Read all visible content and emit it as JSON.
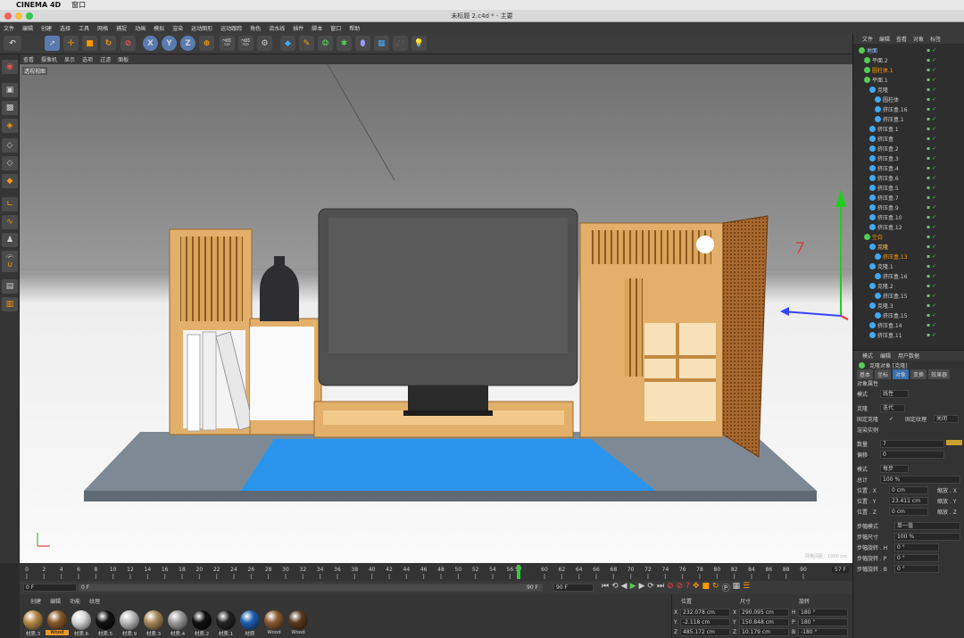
{
  "mac": {
    "app": "CINEMA 4D",
    "menu": "窗口"
  },
  "title": "未标题 2.c4d * - 主要",
  "menus": [
    "文件",
    "编辑",
    "创建",
    "选择",
    "工具",
    "网格",
    "捕捉",
    "动画",
    "模拟",
    "渲染",
    "运动图形",
    "运动跟踪",
    "角色",
    "流水线",
    "插件",
    "脚本",
    "窗口",
    "帮助"
  ],
  "viewport": {
    "menus": [
      "查看",
      "摄像机",
      "显示",
      "选项",
      "过滤",
      "面板"
    ],
    "label": "透视视图",
    "grid": "网格间距：1000 cm"
  },
  "timeline": {
    "ticks": [
      "0",
      "2",
      "4",
      "6",
      "8",
      "10",
      "12",
      "14",
      "16",
      "18",
      "20",
      "22",
      "24",
      "26",
      "28",
      "30",
      "32",
      "34",
      "36",
      "38",
      "40",
      "42",
      "44",
      "46",
      "48",
      "50",
      "52",
      "54",
      "56",
      "57",
      "60",
      "62",
      "64",
      "66",
      "68",
      "70",
      "72",
      "74",
      "76",
      "78",
      "80",
      "82",
      "84",
      "86",
      "88",
      "90"
    ],
    "current": "57 F"
  },
  "transport": {
    "start": "0 F",
    "startb": "0 F",
    "end": "90 F",
    "endb": "90 F"
  },
  "matbar": {
    "menus": [
      "创建",
      "编辑",
      "功能",
      "纹理"
    ],
    "materials": [
      "材质.3",
      "Wood",
      "材质.6",
      "材质.5",
      "材质.9",
      "材质.3",
      "材质.4",
      "材质.2",
      "材质.1",
      "材质",
      "Wood",
      "Wood"
    ],
    "colors": [
      "#b58a4a",
      "#8b5a2b",
      "#d8d8d8",
      "#111111",
      "#bdbdbd",
      "#a88a5a",
      "#9e9e9e",
      "#111111",
      "#222222",
      "#1f5fb0",
      "#8a5a30",
      "#5a3a20"
    ]
  },
  "coords": {
    "headers": [
      "位置",
      "尺寸",
      "旋转"
    ],
    "rows": [
      [
        "X",
        "232.078 cm",
        "X",
        "290.095 cm",
        "H",
        "180 °"
      ],
      [
        "Y",
        "-2.118 cm",
        "Y",
        "150.848 cm",
        "P",
        "180 °"
      ],
      [
        "Z",
        "485.172 cm",
        "Z",
        "10.179 cm",
        "B",
        "-180 °"
      ]
    ]
  },
  "objmgr": {
    "tabs": [
      "文件",
      "编辑",
      "查看",
      "对象",
      "标签"
    ],
    "items": [
      {
        "name": "地面",
        "indent": 0,
        "color": "#9cf"
      },
      {
        "name": "平面.2",
        "indent": 1,
        "color": "#ccc"
      },
      {
        "name": "圆柱体.1",
        "indent": 1,
        "color": "#f90"
      },
      {
        "name": "平面.1",
        "indent": 1,
        "color": "#ccc"
      },
      {
        "name": "克隆",
        "indent": 2,
        "color": "#ccc"
      },
      {
        "name": "圆柱体",
        "indent": 3,
        "color": "#ccc"
      },
      {
        "name": "挤压盒.16",
        "indent": 3,
        "color": "#ccc"
      },
      {
        "name": "挤压盒.1",
        "indent": 3,
        "color": "#ccc"
      },
      {
        "name": "挤压盒.1",
        "indent": 2,
        "color": "#ccc"
      },
      {
        "name": "挤压盒",
        "indent": 2,
        "color": "#ccc"
      },
      {
        "name": "挤压盒.2",
        "indent": 2,
        "color": "#ccc"
      },
      {
        "name": "挤压盒.3",
        "indent": 2,
        "color": "#ccc"
      },
      {
        "name": "挤压盒.4",
        "indent": 2,
        "color": "#ccc"
      },
      {
        "name": "挤压盒.6",
        "indent": 2,
        "color": "#ccc"
      },
      {
        "name": "挤压盒.5",
        "indent": 2,
        "color": "#ccc"
      },
      {
        "name": "挤压盒.7",
        "indent": 2,
        "color": "#ccc"
      },
      {
        "name": "挤压盒.9",
        "indent": 2,
        "color": "#ccc"
      },
      {
        "name": "挤压盒.10",
        "indent": 2,
        "color": "#ccc"
      },
      {
        "name": "挤压盒.12",
        "indent": 2,
        "color": "#ccc"
      },
      {
        "name": "空白",
        "indent": 1,
        "color": "#f90"
      },
      {
        "name": "克隆",
        "indent": 2,
        "color": "#fc6"
      },
      {
        "name": "挤压盒.13",
        "indent": 3,
        "color": "#f90"
      },
      {
        "name": "克隆.1",
        "indent": 2,
        "color": "#ccc"
      },
      {
        "name": "挤压盒.16",
        "indent": 3,
        "color": "#ccc"
      },
      {
        "name": "克隆.2",
        "indent": 2,
        "color": "#ccc"
      },
      {
        "name": "挤压盒.15",
        "indent": 3,
        "color": "#ccc"
      },
      {
        "name": "克隆.3",
        "indent": 2,
        "color": "#ccc"
      },
      {
        "name": "挤压盒.15",
        "indent": 3,
        "color": "#ccc"
      },
      {
        "name": "挤压盒.14",
        "indent": 2,
        "color": "#ccc"
      },
      {
        "name": "挤压盒.11",
        "indent": 2,
        "color": "#ccc"
      }
    ]
  },
  "attr": {
    "tabs": [
      "模式",
      "编辑",
      "用户数据"
    ],
    "title": "克隆对象 [克隆]",
    "subtabs": [
      "基本",
      "坐标",
      "对象",
      "变换",
      "效果器"
    ],
    "section": "对象属性",
    "mode_label": "模式",
    "mode_val": "线性",
    "clones_label": "克隆",
    "clones_val": "迭代",
    "fix_label": "固定克隆",
    "fix_val": "✓",
    "fixtex_label": "固定纹理",
    "fixtex_val": "关闭",
    "render_label": "渲染实例",
    "count_label": "数量",
    "count_val": "7",
    "offset_label": "偏移",
    "offset_val": "0",
    "mode2_label": "模式",
    "mode2_val": "每步",
    "total_label": "总计",
    "total_val": "100 %",
    "pos_label": "位置 . X",
    "pos_x": "0 cm",
    "posy_label": "位置 . Y",
    "pos_y": "23.411 cm",
    "posz_label": "位置 . Z",
    "pos_z": "0 cm",
    "scx": "缩放 . X",
    "scy": "缩放 . Y",
    "scz": "缩放 . Z",
    "step_label": "步幅模式",
    "step_val": "单一值",
    "stepsz_label": "步幅尺寸",
    "stepsz_val": "100 %",
    "rh_label": "步幅旋转 . H",
    "rh_val": "0 °",
    "rp_label": "步幅旋转 . P",
    "rp_val": "0 °",
    "rb_label": "步幅旋转 . B",
    "rb_val": "0 °"
  }
}
